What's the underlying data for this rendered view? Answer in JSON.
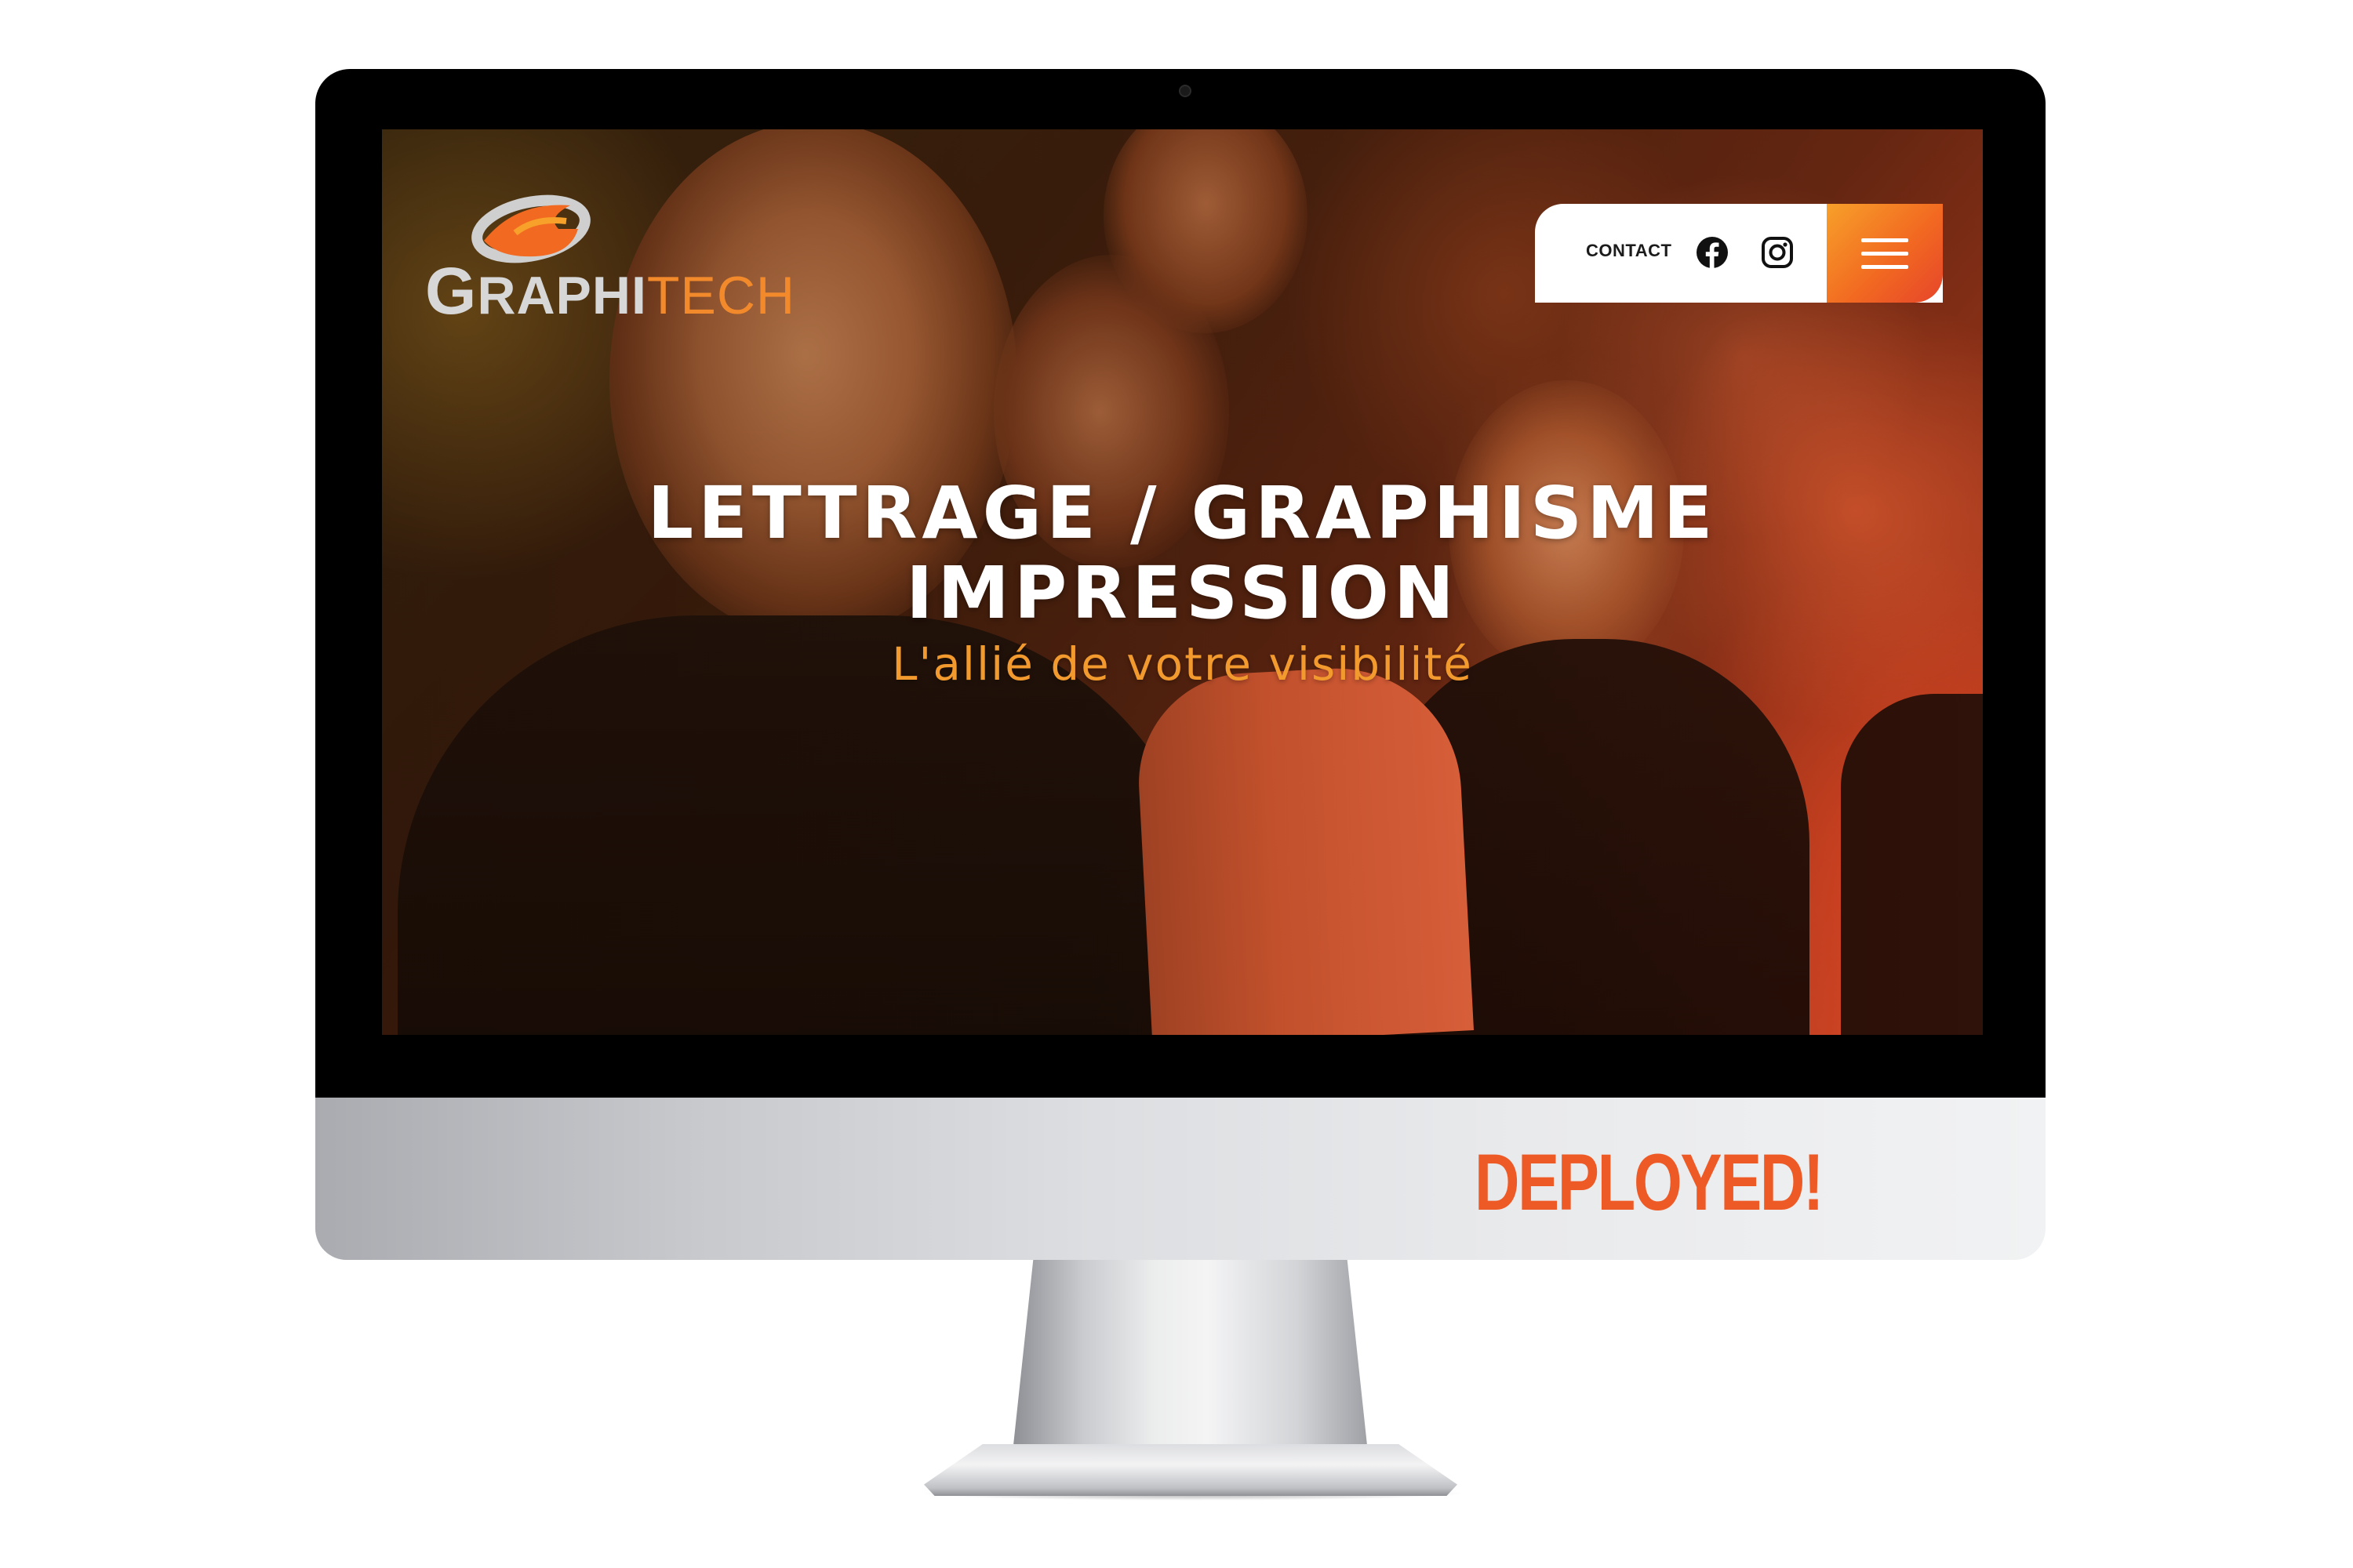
{
  "website": {
    "logo": {
      "text_part1": "G",
      "text_part2": "RAPHI",
      "text_part3": "TECH"
    },
    "nav": {
      "contact_label": "CONTACT",
      "facebook_icon": "facebook-icon",
      "instagram_icon": "instagram-icon",
      "menu_icon": "hamburger-menu-icon"
    },
    "hero": {
      "title_line1": "LETTRAGE / GRAPHISME",
      "title_line2": "IMPRESSION",
      "subtitle": "L'allié de votre visibilité"
    }
  },
  "monitor": {
    "chin_label": "DEPLOYED!"
  },
  "colors": {
    "accent_orange": "#f26a21",
    "subtitle_orange": "#f29a2e",
    "deployed_red": "#ee5a26",
    "nav_bg": "#ffffff"
  }
}
